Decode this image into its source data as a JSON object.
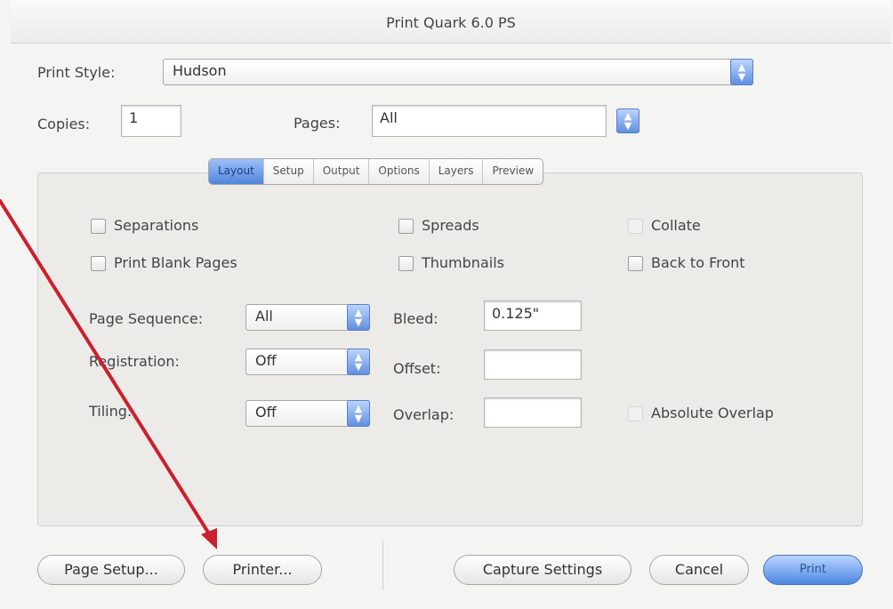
{
  "window": {
    "title": "Print Quark 6.0 PS"
  },
  "print_style": {
    "label": "Print Style:",
    "value": "Hudson"
  },
  "copies": {
    "label": "Copies:",
    "value": "1"
  },
  "pages": {
    "label": "Pages:",
    "value": "All"
  },
  "tabs": [
    {
      "label": "Layout",
      "active": true
    },
    {
      "label": "Setup"
    },
    {
      "label": "Output"
    },
    {
      "label": "Options"
    },
    {
      "label": "Layers"
    },
    {
      "label": "Preview"
    }
  ],
  "checkboxes": {
    "separations": {
      "label": "Separations",
      "checked": false
    },
    "print_blank_pages": {
      "label": "Print Blank Pages",
      "checked": false
    },
    "spreads": {
      "label": "Spreads",
      "checked": false
    },
    "thumbnails": {
      "label": "Thumbnails",
      "checked": false
    },
    "collate": {
      "label": "Collate",
      "checked": false,
      "disabled": true
    },
    "back_to_front": {
      "label": "Back to Front",
      "checked": false
    },
    "absolute_overlap": {
      "label": "Absolute Overlap",
      "checked": false,
      "disabled": true
    }
  },
  "page_sequence": {
    "label": "Page Sequence:",
    "value": "All"
  },
  "registration": {
    "label": "Registration:",
    "value": "Off"
  },
  "tiling": {
    "label": "Tiling:",
    "value": "Off"
  },
  "bleed": {
    "label": "Bleed:",
    "value": "0.125\""
  },
  "offset": {
    "label": "Offset:",
    "value": ""
  },
  "overlap": {
    "label": "Overlap:",
    "value": ""
  },
  "buttons": {
    "page_setup": "Page Setup...",
    "printer": "Printer...",
    "capture_settings": "Capture Settings",
    "cancel": "Cancel",
    "print": "Print"
  },
  "colors": {
    "accent": "#5f8fe0",
    "annotation_arrow": "#cc1f2e"
  }
}
